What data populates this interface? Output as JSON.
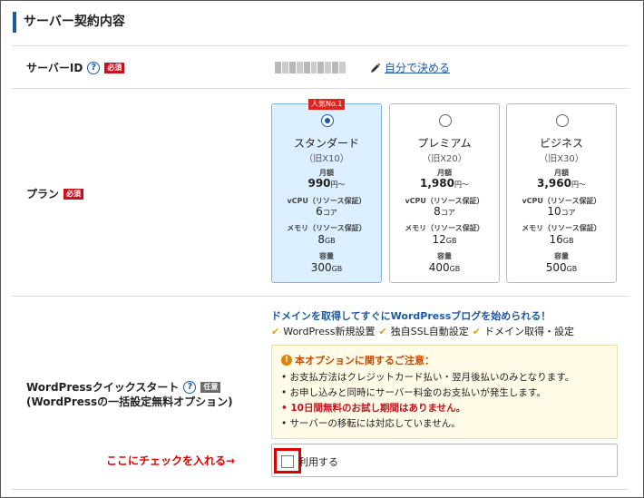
{
  "section": {
    "title": "サーバー契約内容"
  },
  "server_id": {
    "label": "サーバーID",
    "required": "必須",
    "decide_link": "自分で決める"
  },
  "plan": {
    "label": "プラン",
    "required": "必須",
    "popular_badge": "人気No.1",
    "monthly_label": "月額",
    "vcpu_label": "vCPU（リソース保証）",
    "memory_label": "メモリ（リソース保証）",
    "storage_label": "容量",
    "options": [
      {
        "name": "スタンダード",
        "old": "（旧X10）",
        "price": "990",
        "price_unit": "円～",
        "vcpu": "6",
        "vcpu_unit": "コア",
        "memory": "8",
        "memory_unit": "GB",
        "storage": "300",
        "storage_unit": "GB",
        "selected": true
      },
      {
        "name": "プレミアム",
        "old": "（旧X20）",
        "price": "1,980",
        "price_unit": "円～",
        "vcpu": "8",
        "vcpu_unit": "コア",
        "memory": "12",
        "memory_unit": "GB",
        "storage": "400",
        "storage_unit": "GB",
        "selected": false
      },
      {
        "name": "ビジネス",
        "old": "（旧X30）",
        "price": "3,960",
        "price_unit": "円～",
        "vcpu": "10",
        "vcpu_unit": "コア",
        "memory": "16",
        "memory_unit": "GB",
        "storage": "500",
        "storage_unit": "GB",
        "selected": false
      }
    ]
  },
  "quickstart": {
    "label": "WordPressクイックスタート",
    "optional": "任意",
    "sublabel": "(WordPressの一括設定無料オプション)",
    "promo": "ドメインを取得してすぐにWordPressブログを始められる！",
    "features": [
      "WordPress新規設置",
      "独自SSL自動設定",
      "ドメイン取得・設定"
    ],
    "notice_title": "本オプションに関するご注意：",
    "notices": [
      "お支払方法はクレジットカード払い・翌月後払いのみとなります。",
      "お申し込みと同時にサーバー料金のお支払いが発生します。",
      "10日間無料のお試し期間はありません。",
      "サーバーの移転には対応していません。"
    ],
    "use_label": "利用する",
    "annotation": "ここにチェックを入れる→"
  },
  "colors": {
    "accent": "#1c5aa6",
    "required": "#c8101e",
    "highlight": "#e00000",
    "selected_bg": "#dcefff"
  }
}
